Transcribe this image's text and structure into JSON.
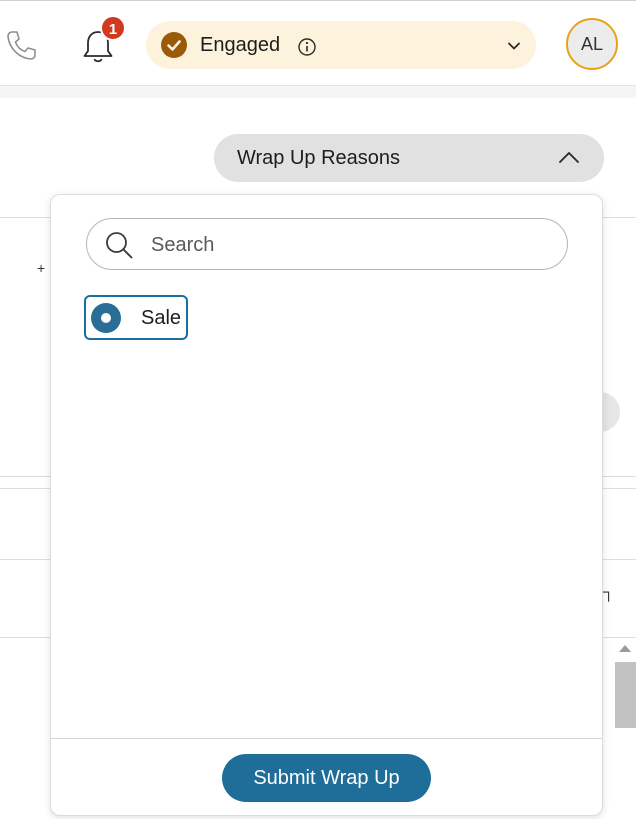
{
  "header": {
    "phone_icon": "phone-icon",
    "bell_icon": "bell-icon",
    "notification_count": "1",
    "agent_state": {
      "label": "Engaged",
      "status_color": "#9a5a0a",
      "background": "#fdf3dc"
    },
    "avatar_initials": "AL",
    "avatar_ring_color": "#e8a21a"
  },
  "wrap_up": {
    "button_label": "Wrap Up Reasons",
    "search": {
      "placeholder": "Search",
      "value": ""
    },
    "options": [
      {
        "label": "Sale",
        "selected": true
      }
    ],
    "submit_label": "Submit Wrap Up",
    "accent_color": "#1f6e9a"
  },
  "background": {
    "plus_glyph": "+"
  }
}
